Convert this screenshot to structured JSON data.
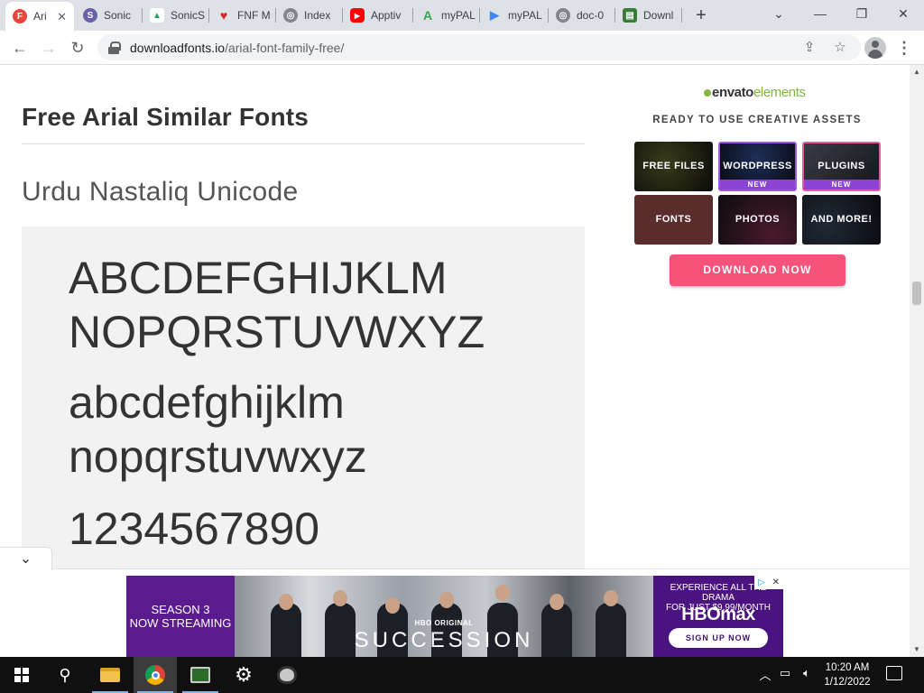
{
  "browser": {
    "tabs": [
      {
        "title": "Ari",
        "favicon": "F",
        "color": "#e8453c",
        "active": true
      },
      {
        "title": "Sonic",
        "favicon": "S",
        "color": "#6b5fa8",
        "active": false
      },
      {
        "title": "SonicS",
        "favicon": "▲",
        "color": "#1fa463",
        "active": false
      },
      {
        "title": "FNF M",
        "favicon": "♥",
        "color": "#d62828",
        "active": false
      },
      {
        "title": "Index",
        "favicon": "◎",
        "color": "#80868b",
        "active": false
      },
      {
        "title": "Apptiv",
        "favicon": "▶",
        "color": "#ff0000",
        "active": false
      },
      {
        "title": "myPAL",
        "favicon": "A",
        "color": "#34a853",
        "active": false
      },
      {
        "title": "myPAL",
        "favicon": "▶",
        "color": "#4285f4",
        "active": false
      },
      {
        "title": "doc-0",
        "favicon": "◎",
        "color": "#80868b",
        "active": false
      },
      {
        "title": "Downl",
        "favicon": "▤",
        "color": "#3a7d3a",
        "active": false
      }
    ],
    "new_tab": "+",
    "url_host": "downloadfonts.io",
    "url_path": "/arial-font-family-free/"
  },
  "page": {
    "heading": "Free Arial Similar Fonts",
    "font_name": "Urdu Nastaliq Unicode",
    "sample_lines": [
      "ABCDEFGHIJKLM",
      "NOPQRSTUVWXYZ",
      "abcdefghijklm",
      "nopqrstuvwxyz",
      "1234567890"
    ]
  },
  "sidebar_ad": {
    "logo_part1": "envato",
    "logo_part2": "elements",
    "tagline": "READY TO USE CREATIVE ASSETS",
    "tiles": [
      {
        "label": "FREE FILES",
        "badge": ""
      },
      {
        "label": "WORDPRESS",
        "badge": "NEW"
      },
      {
        "label": "PLUGINS",
        "badge": "NEW"
      },
      {
        "label": "FONTS",
        "badge": ""
      },
      {
        "label": "PHOTOS",
        "badge": ""
      },
      {
        "label": "AND MORE!",
        "badge": ""
      }
    ],
    "cta": "DOWNLOAD NOW"
  },
  "bottom_ad": {
    "season": "SEASON 3",
    "streaming": "NOW STREAMING",
    "hbo_original": "HBO ORIGINAL",
    "show": "SUCCESSION",
    "offer_line1": "EXPERIENCE ALL THE DRAMA",
    "offer_line2": "FOR JUST $9.99/MONTH",
    "brand": "HBOmax",
    "signup": "SIGN UP NOW"
  },
  "taskbar": {
    "time": "10:20 AM",
    "date": "1/12/2022"
  },
  "colors": {
    "accent_pink": "#f5537a",
    "envato_green": "#82b541",
    "hbo_purple": "#4b1380"
  }
}
